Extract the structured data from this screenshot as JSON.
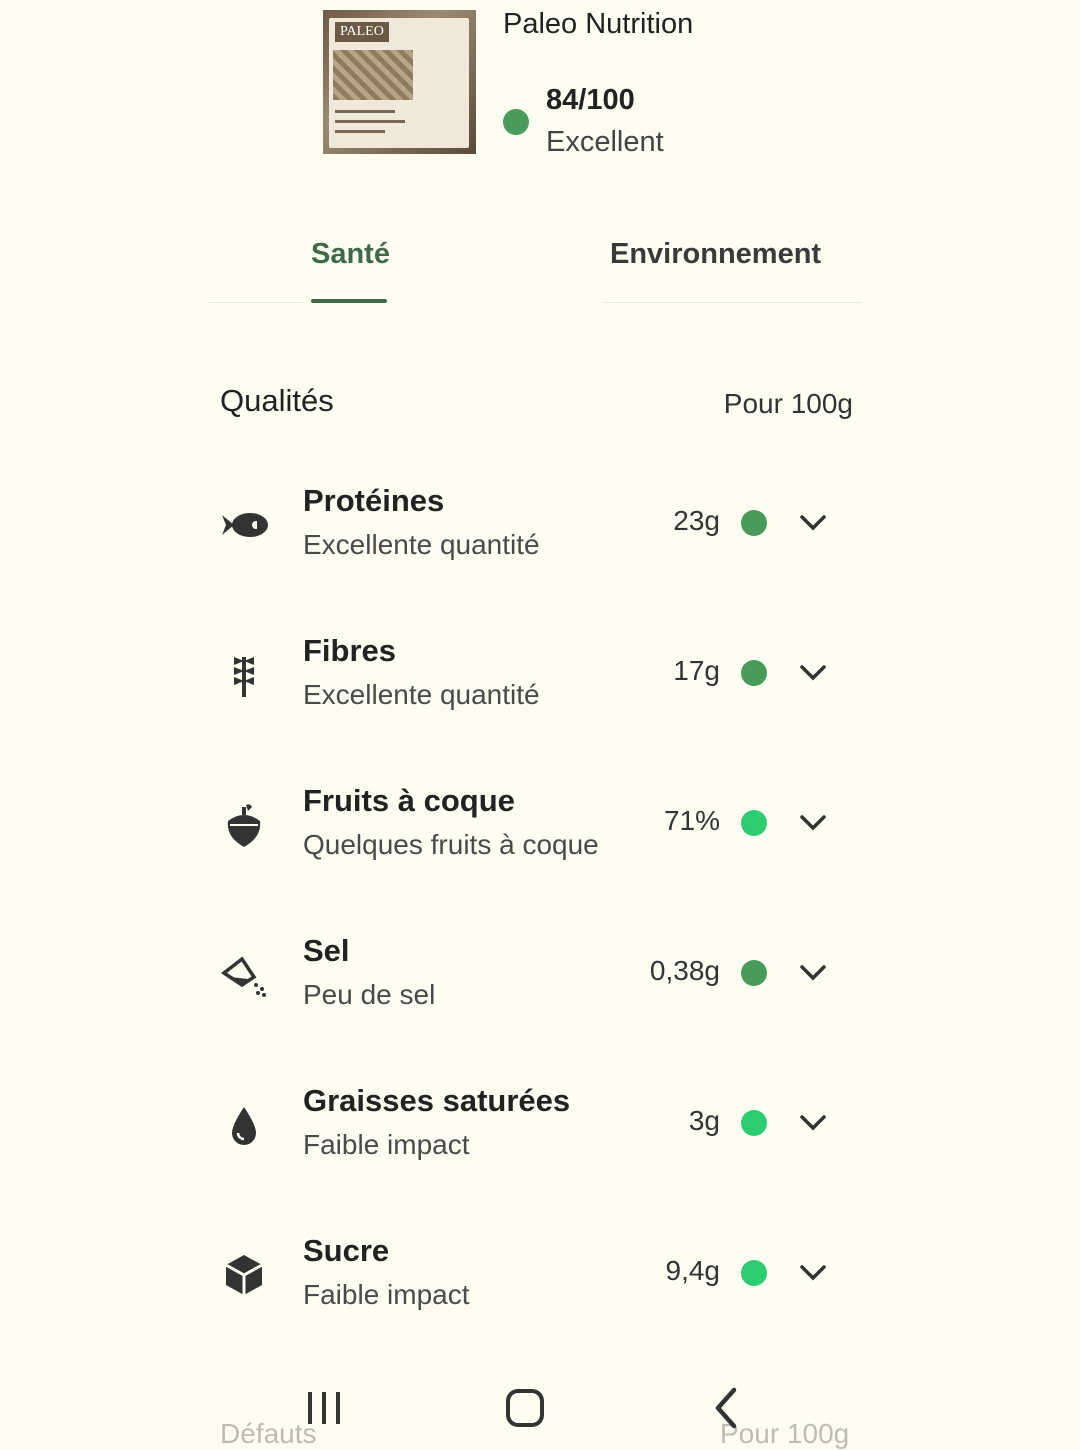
{
  "product": {
    "name": "Paleo Nutrition",
    "image_logo_text": "PALEO",
    "score": "84/100",
    "score_label": "Excellent",
    "score_color": "#4a9b5a"
  },
  "tabs": [
    {
      "label": "Santé",
      "active": true
    },
    {
      "label": "Environnement",
      "active": false
    }
  ],
  "section": {
    "title": "Qualités",
    "per": "Pour 100g"
  },
  "items": [
    {
      "name": "Protéines",
      "desc": "Excellente quantité",
      "value": "23g",
      "dot": "#4a9b5a",
      "icon": "fish-icon"
    },
    {
      "name": "Fibres",
      "desc": "Excellente quantité",
      "value": "17g",
      "dot": "#4a9b5a",
      "icon": "wheat-icon"
    },
    {
      "name": "Fruits à coque",
      "desc": "Quelques fruits à coque",
      "value": "71%",
      "dot": "#2ecc71",
      "icon": "nut-icon"
    },
    {
      "name": "Sel",
      "desc": "Peu de sel",
      "value": "0,38g",
      "dot": "#4a9b5a",
      "icon": "salt-icon"
    },
    {
      "name": "Graisses saturées",
      "desc": "Faible impact",
      "value": "3g",
      "dot": "#2ecc71",
      "icon": "drop-icon"
    },
    {
      "name": "Sucre",
      "desc": "Faible impact",
      "value": "9,4g",
      "dot": "#2ecc71",
      "icon": "sugar-cube-icon"
    }
  ],
  "peek": {
    "left": "Défauts",
    "right": "Pour 100g"
  },
  "navbar": [
    "recent-apps-icon",
    "home-icon",
    "back-icon"
  ]
}
